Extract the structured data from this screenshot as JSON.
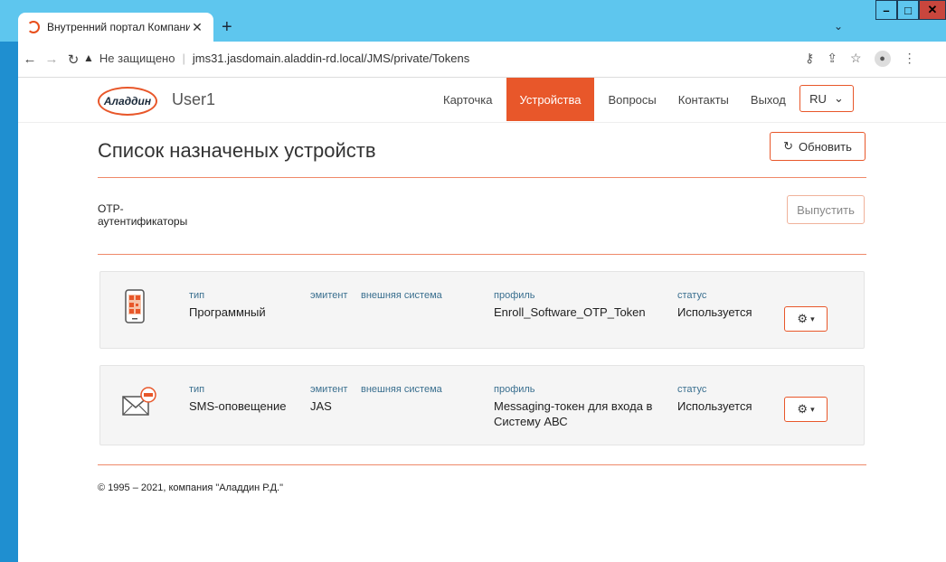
{
  "browser": {
    "tab_title": "Внутренний портал Компании",
    "tab_close": "✕",
    "new_tab": "+",
    "not_secure": "Не защищено",
    "url": "jms31.jasdomain.aladdin-rd.local/JMS/private/Tokens"
  },
  "header": {
    "logo_text": "Аладдин",
    "username": "User1",
    "nav": [
      "Карточка",
      "Устройства",
      "Вопросы",
      "Контакты",
      "Выход"
    ],
    "active_nav": "Устройства",
    "language": "RU"
  },
  "main": {
    "title": "Список назначеных устройств",
    "refresh_label": "Обновить",
    "section_label": "OTP-\nаутентификаторы",
    "issue_label": "Выпустить",
    "field_labels": {
      "type": "тип",
      "issuer": "эмитент",
      "external": "внешняя система",
      "profile": "профиль",
      "status": "статус"
    },
    "devices": [
      {
        "icon": "qr-phone-icon",
        "type": "Программный",
        "issuer": "",
        "external": "",
        "profile": "Enroll_Software_OTP_Token",
        "status": "Используется"
      },
      {
        "icon": "sms-envelope-icon",
        "type": "SMS-оповещение",
        "issuer": "JAS",
        "external": "",
        "profile": "Messaging-токен для входа в Систему АВС",
        "status": "Используется"
      }
    ]
  },
  "footer": "© 1995 – 2021, компания \"Аладдин Р.Д.\"",
  "colors": {
    "accent": "#e8572a",
    "label": "#3a6f8f",
    "chrome": "#5ec6ee"
  }
}
